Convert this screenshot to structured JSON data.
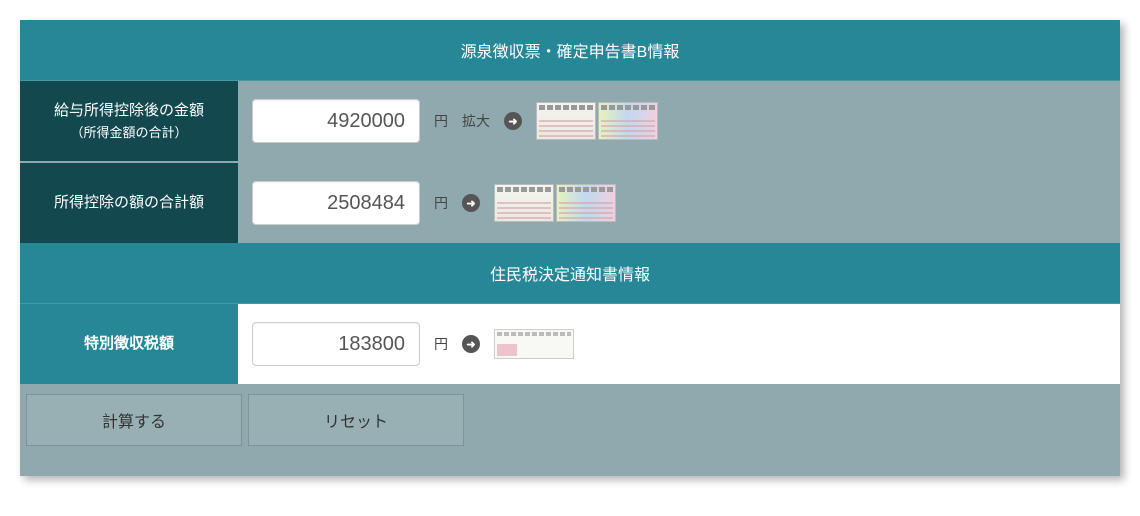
{
  "sections": {
    "header1": "源泉徴収票・確定申告書B情報",
    "header2": "住民税決定通知書情報"
  },
  "rows": {
    "income": {
      "label_line1": "給与所得控除後の金額",
      "label_line2": "（所得金額の合計）",
      "value": "4920000",
      "unit": "円",
      "expand": "拡大"
    },
    "deduction": {
      "label": "所得控除の額の合計額",
      "value": "2508484",
      "unit": "円"
    },
    "special_tax": {
      "label": "特別徴収税額",
      "value": "183800",
      "unit": "円"
    }
  },
  "buttons": {
    "calculate": "計算する",
    "reset": "リセット"
  }
}
